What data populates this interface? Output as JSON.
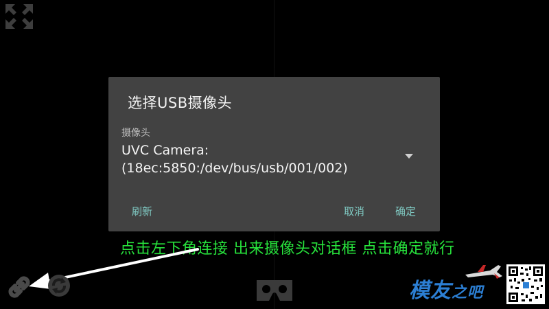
{
  "dialog": {
    "title": "选择USB摄像头",
    "camera_label": "摄像头",
    "camera_value": "UVC Camera:(18ec:5850:/dev/bus/usb/001/002)",
    "refresh_label": "刷新",
    "cancel_label": "取消",
    "ok_label": "确定"
  },
  "instruction_text": "点击左下角连接 出来摄像头对话框 点击确定就行",
  "watermark": {
    "brand_main": "模友",
    "brand_small": "之吧"
  },
  "colors": {
    "dialog_bg": "#424242",
    "dialog_button": "#80cbc4",
    "instruction": "#27e33c",
    "background": "#000000"
  },
  "icons": {
    "fullscreen": "fullscreen-icon",
    "link": "link-icon",
    "sync": "sync-icon",
    "vr": "vr-headset-icon",
    "dropdown": "dropdown-arrow-icon"
  }
}
